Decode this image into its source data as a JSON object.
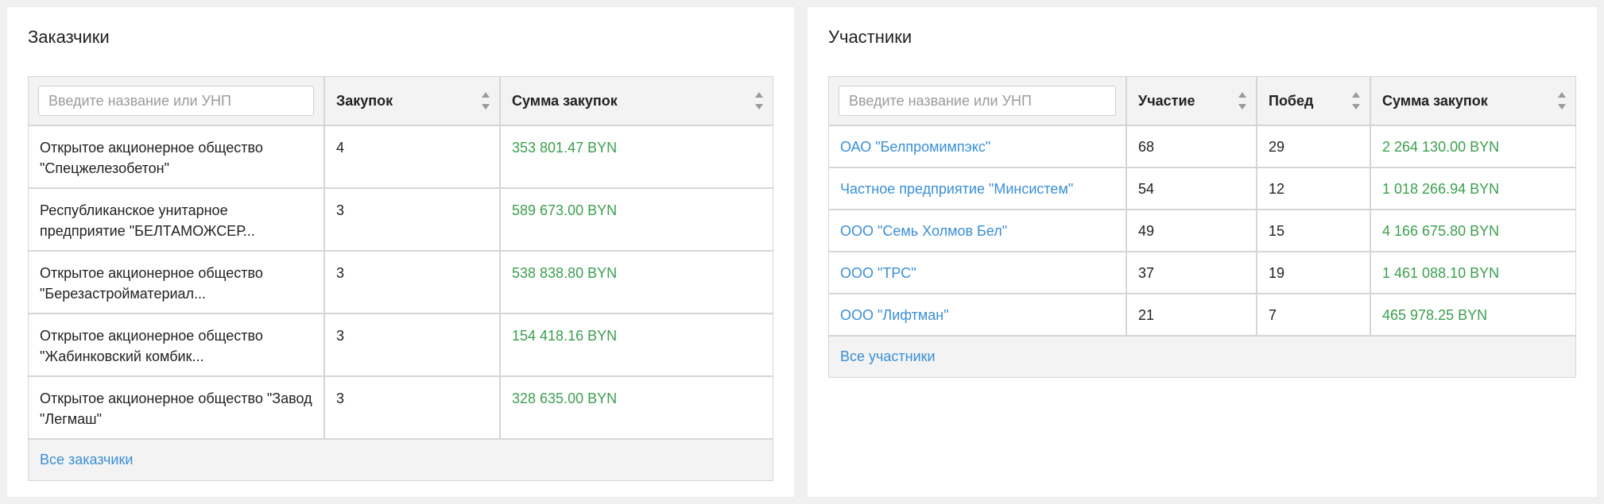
{
  "customers": {
    "title": "Заказчики",
    "search_placeholder": "Введите название или УНП",
    "columns": [
      "Закупок",
      "Сумма закупок"
    ],
    "rows": [
      {
        "name": "Открытое акционерное общество \"Спецжелезобетон\"",
        "count": "4",
        "sum": "353 801.47 BYN"
      },
      {
        "name": "Республиканское унитарное предприятие \"БЕЛТАМОЖСЕР...",
        "count": "3",
        "sum": "589 673.00 BYN"
      },
      {
        "name": "Открытое акционерное общество \"Березастройматериал...",
        "count": "3",
        "sum": "538 838.80 BYN"
      },
      {
        "name": "Открытое акционерное общество \"Жабинковский комбик...",
        "count": "3",
        "sum": "154 418.16 BYN"
      },
      {
        "name": "Открытое акционерное общество \"Завод \"Легмаш\"",
        "count": "3",
        "sum": "328 635.00 BYN"
      }
    ],
    "footer_link": "Все заказчики"
  },
  "participants": {
    "title": "Участники",
    "search_placeholder": "Введите название или УНП",
    "columns": [
      "Участие",
      "Побед",
      "Сумма закупок"
    ],
    "rows": [
      {
        "name": "ОАО \"Белпромимпэкс\"",
        "participation": "68",
        "wins": "29",
        "sum": "2 264 130.00 BYN"
      },
      {
        "name": "Частное предприятие \"Минсистем\"",
        "participation": "54",
        "wins": "12",
        "sum": "1 018 266.94 BYN"
      },
      {
        "name": "ООО \"Семь Холмов Бел\"",
        "participation": "49",
        "wins": "15",
        "sum": "4 166 675.80 BYN"
      },
      {
        "name": "ООО \"ТРС\"",
        "participation": "37",
        "wins": "19",
        "sum": "1 461 088.10 BYN"
      },
      {
        "name": "ООО \"Лифтман\"",
        "participation": "21",
        "wins": "7",
        "sum": "465 978.25 BYN"
      }
    ],
    "footer_link": "Все участники"
  },
  "icons": {
    "sort": "sort-arrows-icon"
  },
  "colors": {
    "money": "#3c9f4f",
    "link": "#3a8fd6",
    "header_bg": "#f3f3f3",
    "border": "#d6d6d6"
  }
}
